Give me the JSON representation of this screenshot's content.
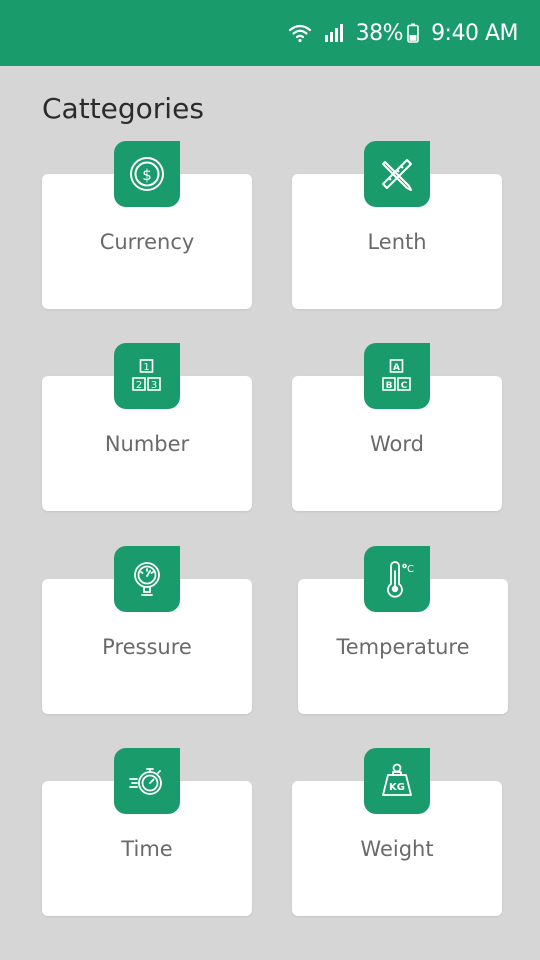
{
  "status_bar": {
    "battery": "38%",
    "time": "9:40 AM",
    "icons": [
      "wifi-icon",
      "signal-icon",
      "battery-icon"
    ]
  },
  "page_title": "Cattegories",
  "colors": {
    "accent": "#1a9b6c",
    "background": "#d6d6d6",
    "card": "#ffffff",
    "label": "#6a6a6a"
  },
  "categories": [
    {
      "label": "Currency",
      "icon": "currency-icon"
    },
    {
      "label": "Lenth",
      "icon": "ruler-pencil-icon"
    },
    {
      "label": "Number",
      "icon": "number-blocks-icon"
    },
    {
      "label": "Word",
      "icon": "letter-blocks-icon"
    },
    {
      "label": "Pressure",
      "icon": "pressure-gauge-icon"
    },
    {
      "label": "Temperature",
      "icon": "thermometer-icon"
    },
    {
      "label": "Time",
      "icon": "stopwatch-icon"
    },
    {
      "label": "Weight",
      "icon": "weight-icon"
    }
  ]
}
